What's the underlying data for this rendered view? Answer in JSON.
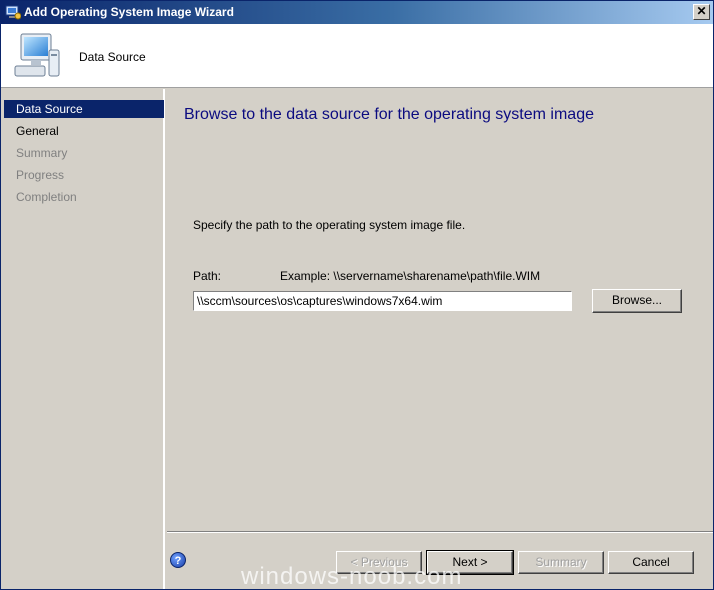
{
  "window": {
    "title": "Add Operating System Image Wizard",
    "close_label": "✕"
  },
  "header": {
    "title": "Data Source"
  },
  "nav": {
    "items": [
      {
        "label": "Data Source",
        "state": "active"
      },
      {
        "label": "General",
        "state": "enabled"
      },
      {
        "label": "Summary",
        "state": "disabled"
      },
      {
        "label": "Progress",
        "state": "disabled"
      },
      {
        "label": "Completion",
        "state": "disabled"
      }
    ]
  },
  "main": {
    "heading": "Browse to the data source for the operating system image",
    "instruction": "Specify the path to the operating system image file.",
    "path_label": "Path:",
    "example": "Example: \\\\servername\\sharename\\path\\file.WIM",
    "path_value": "\\\\sccm\\sources\\os\\captures\\windows7x64.wim",
    "browse_label": "Browse..."
  },
  "footer": {
    "help_glyph": "?",
    "previous_label": "< Previous",
    "next_label": "Next >",
    "summary_label": "Summary",
    "cancel_label": "Cancel"
  },
  "watermark": "windows-noob.com",
  "colors": {
    "title_bar": "#0a246a",
    "heading": "#0b0b80",
    "nav_active": "#0a246a",
    "face": "#d4d0c8"
  }
}
